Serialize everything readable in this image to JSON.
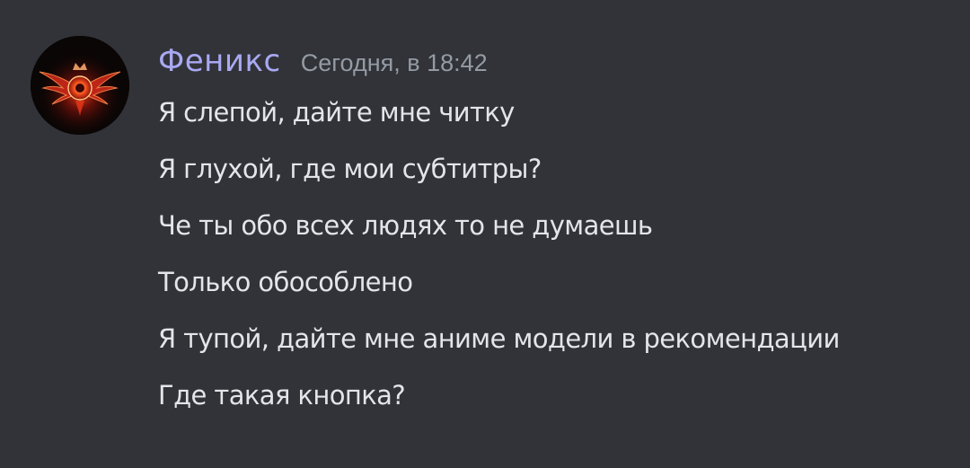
{
  "message": {
    "author": "Феникс",
    "timestamp": "Сегодня, в 18:42",
    "avatar_icon": "phoenix-emblem-icon",
    "lines": [
      "Я слепой, дайте мне читку",
      "Я глухой, где мои субтитры?",
      "Че ты обо всех людях то не думаешь",
      "Только обособлено",
      "Я тупой, дайте мне аниме модели в рекомендации",
      "Где такая кнопка?"
    ]
  },
  "colors": {
    "background": "#313338",
    "username": "#a9a8f2",
    "timestamp": "#949ba4",
    "text": "#e3e5e8",
    "avatar_accent": "#e8381c"
  }
}
